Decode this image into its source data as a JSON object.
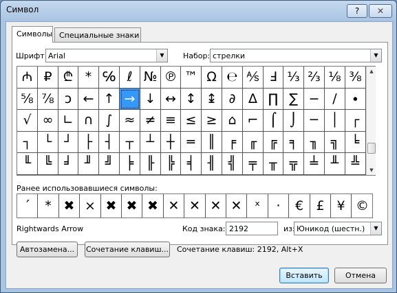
{
  "window": {
    "title": "Символ",
    "help_label": "?",
    "close_label": "✕"
  },
  "tabs": [
    {
      "label": "Символы"
    },
    {
      "label": "Специальные знаки"
    }
  ],
  "font": {
    "label": "Шрифт:",
    "value": "Arial"
  },
  "subset": {
    "label": "Набор:",
    "value": "стрелки"
  },
  "grid": {
    "rows": [
      [
        "₼",
        "₽",
        "₾",
        "*",
        "℅",
        "ℓ",
        "№",
        "℗",
        "™",
        "Ω",
        "℮",
        "⅍",
        "Ⅎ",
        "⅓",
        "⅔",
        "⅛",
        "⅜"
      ],
      [
        "⅝",
        "⅞",
        "ↄ",
        "←",
        "↑",
        "→",
        "↓",
        "↔",
        "↕",
        "↨",
        "∂",
        "∆",
        "∏",
        "∑",
        "−",
        "∕",
        "∙"
      ],
      [
        "√",
        "∞",
        "∟",
        "∩",
        "∫",
        "≈",
        "≠",
        "≡",
        "≤",
        "≥",
        "⌂",
        "⌐",
        "⌠",
        "⌡",
        "─",
        "│",
        "┌"
      ],
      [
        "┐",
        "└",
        "┘",
        "├",
        "┤",
        "┬",
        "┴",
        "┼",
        "═",
        "║",
        "╒",
        "╓",
        "╔",
        "╕",
        "╖",
        "╗",
        "╘"
      ],
      [
        "╙",
        "╚",
        "╛",
        "╜",
        "╝",
        "╞",
        "╟",
        "╠",
        "╡",
        "╢",
        "╣",
        "╤",
        "╥",
        "╦",
        "╧",
        "╨",
        "╩"
      ]
    ],
    "selected_row": 1,
    "selected_col": 5
  },
  "recent": {
    "label": "Ранее использовавшиеся символы:",
    "symbols": [
      "´",
      "*",
      "✖",
      "×",
      "✖",
      "✖",
      "✖",
      "✕",
      "✕",
      "✕",
      "✕",
      "ˣ",
      "·",
      "€",
      "£",
      "¥",
      "©"
    ]
  },
  "char_name": "Rightwards Arrow",
  "code": {
    "label": "Код знака:",
    "value": "2192"
  },
  "from": {
    "label": "из:",
    "value": "Юникод (шестн.)"
  },
  "buttons": {
    "autocorrect": "Автозамена...",
    "shortcut_key": "Сочетание клавиш...",
    "insert": "Вставить",
    "cancel": "Отмена"
  },
  "shortcut_text": "Сочетание клавиш: 2192, Alt+X",
  "icons": {
    "dropdown": "chevron-down-icon",
    "scroll_up": "scroll-up-icon",
    "scroll_down": "scroll-down-icon"
  }
}
